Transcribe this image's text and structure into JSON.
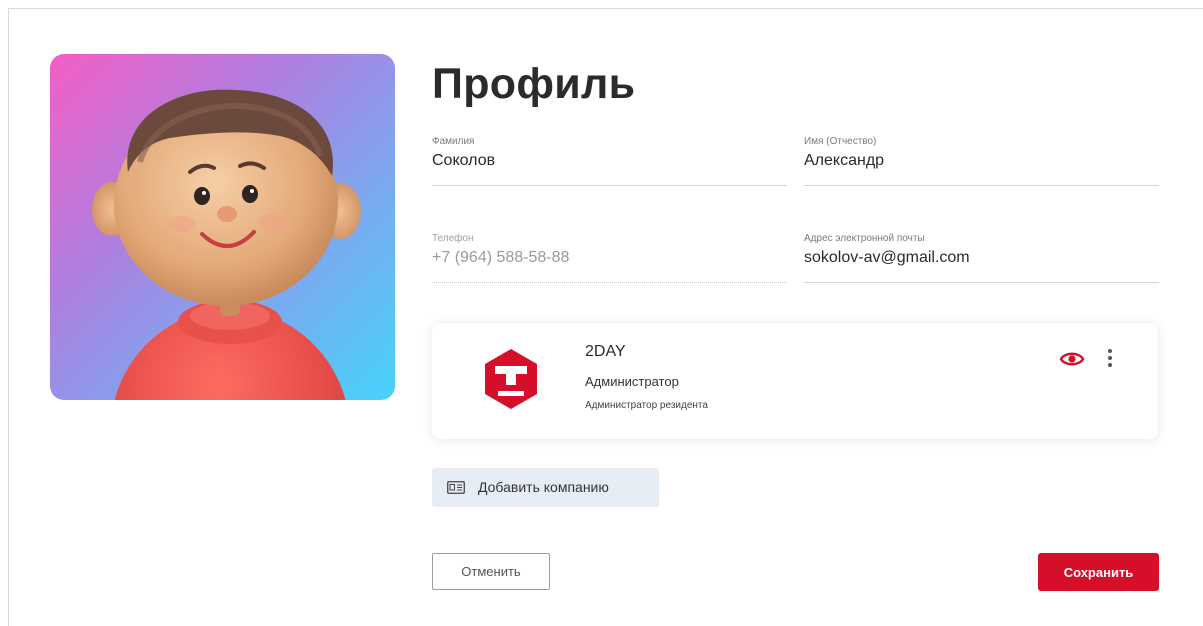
{
  "profile": {
    "title": "Профиль",
    "avatar_icon": "user-avatar-3d"
  },
  "fields": {
    "last_name": {
      "label": "Фамилия",
      "value": "Соколов"
    },
    "first_name": {
      "label": "Имя (Отчество)",
      "value": "Александр"
    },
    "phone": {
      "label": "Телефон",
      "value": "+7 (964) 588-58-88",
      "disabled": true
    },
    "email": {
      "label": "Адрес электронной почты",
      "value": "sokolov-av@gmail.com"
    }
  },
  "company": {
    "name": "2DAY",
    "role": "Администратор",
    "subrole": "Администратор резидента",
    "logo_icon": "company-hexagon-logo",
    "logo_color": "#d50f2a",
    "actions": {
      "view_icon": "eye-icon",
      "menu_icon": "more-vertical-icon"
    }
  },
  "actions": {
    "add_company_label": "Добавить компанию",
    "add_company_icon": "id-card-icon",
    "cancel_label": "Отменить",
    "save_label": "Сохранить"
  },
  "colors": {
    "accent": "#d50f2a",
    "secondary_button_bg": "#e6edf5"
  }
}
